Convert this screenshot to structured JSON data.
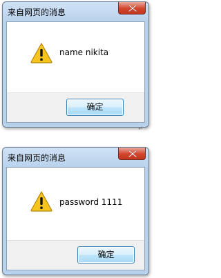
{
  "dialogs": [
    {
      "title": "来自网页的消息",
      "message": "name nikita",
      "ok_label": "确定"
    },
    {
      "title": "来自网页的消息",
      "message": "password 1111",
      "ok_label": "确定"
    }
  ],
  "icons": {
    "warning": "warning-icon",
    "close": "close-icon"
  },
  "colors": {
    "title_bar": "#b9d2ec",
    "close_button": "#d2442c",
    "warning": "#f5c51e"
  },
  "paragraph_mark": "↵"
}
